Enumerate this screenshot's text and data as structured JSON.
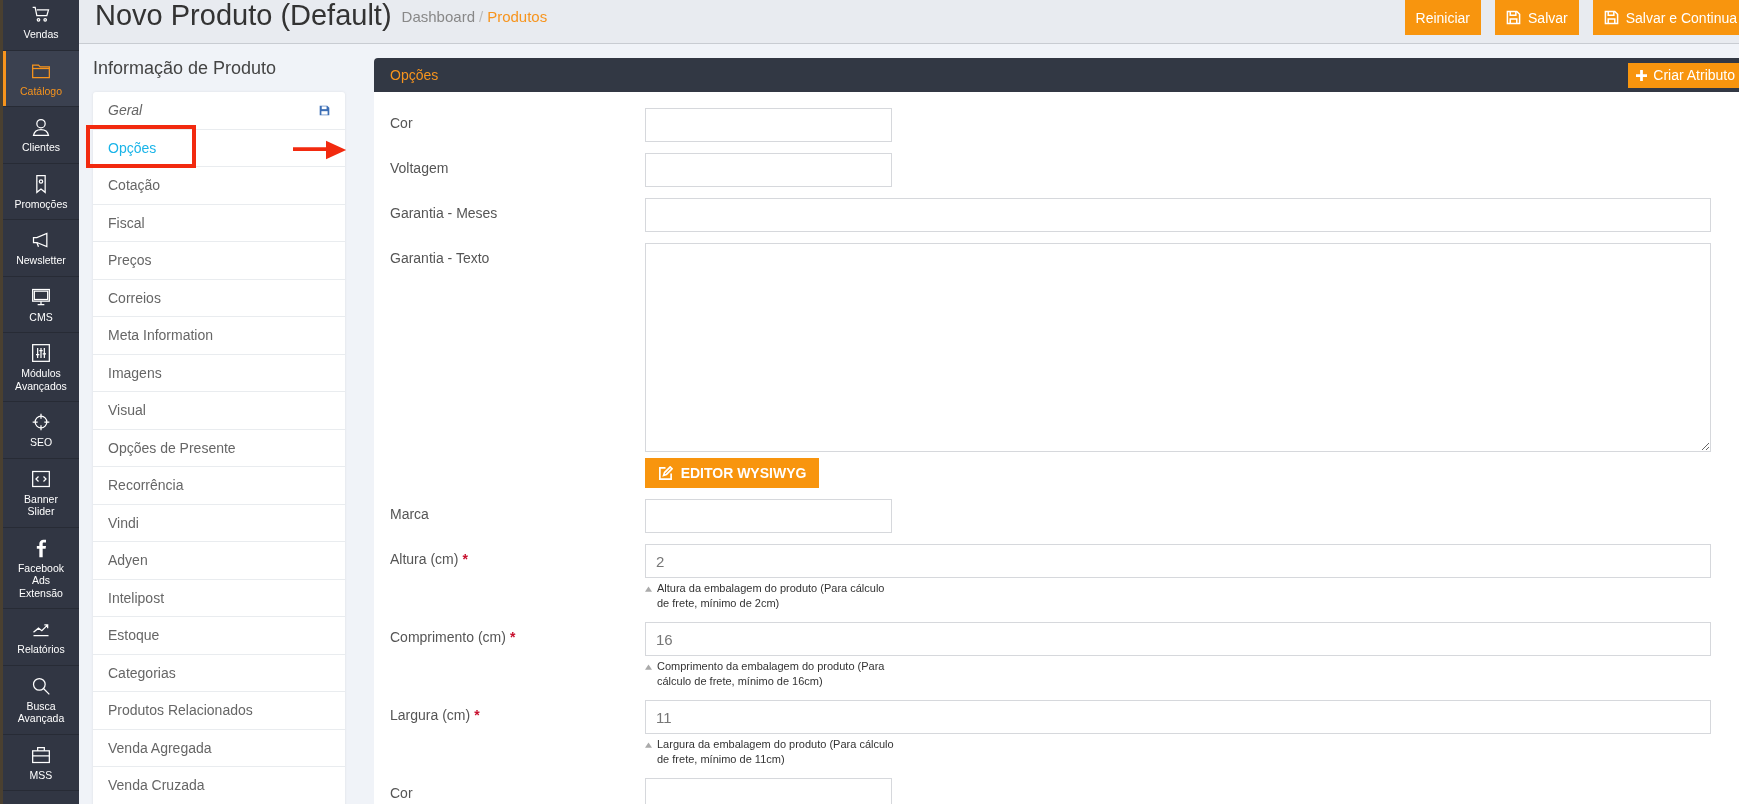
{
  "sidebar": {
    "items": [
      {
        "label": "Vendas",
        "selected": false
      },
      {
        "label": "Catálogo",
        "selected": true
      },
      {
        "label": "Clientes",
        "selected": false
      },
      {
        "label": "Promoções",
        "selected": false
      },
      {
        "label": "Newsletter",
        "selected": false
      },
      {
        "label": "CMS",
        "selected": false
      },
      {
        "label": "Módulos\nAvançados",
        "selected": false
      },
      {
        "label": "SEO",
        "selected": false
      },
      {
        "label": "Banner\nSlider",
        "selected": false
      },
      {
        "label": "Facebook\nAds\nExtensão",
        "selected": false
      },
      {
        "label": "Relatórios",
        "selected": false
      },
      {
        "label": "Busca\nAvançada",
        "selected": false
      },
      {
        "label": "MSS",
        "selected": false
      }
    ]
  },
  "header": {
    "title": "Novo Produto (Default)",
    "breadcrumb": {
      "items": [
        "Dashboard",
        "Produtos"
      ],
      "separator": "/"
    },
    "buttons": [
      {
        "label": "Reiniciar",
        "icon": false
      },
      {
        "label": "Salvar",
        "icon": true
      },
      {
        "label": "Salvar e Continua",
        "icon": true
      }
    ]
  },
  "product_tabs": {
    "title": "Informação de Produto",
    "items": [
      {
        "label": "Geral",
        "kind": "heading",
        "selected": false
      },
      {
        "label": "Opções",
        "kind": "tab",
        "selected": true
      },
      {
        "label": "Cotação",
        "kind": "tab",
        "selected": false
      },
      {
        "label": "Fiscal",
        "kind": "tab",
        "selected": false
      },
      {
        "label": "Preços",
        "kind": "tab",
        "selected": false
      },
      {
        "label": "Correios",
        "kind": "tab",
        "selected": false
      },
      {
        "label": "Meta Information",
        "kind": "tab",
        "selected": false
      },
      {
        "label": "Imagens",
        "kind": "tab",
        "selected": false
      },
      {
        "label": "Visual",
        "kind": "tab",
        "selected": false
      },
      {
        "label": "Opções de Presente",
        "kind": "tab",
        "selected": false
      },
      {
        "label": "Recorrência",
        "kind": "tab",
        "selected": false
      },
      {
        "label": "Vindi",
        "kind": "tab",
        "selected": false
      },
      {
        "label": "Adyen",
        "kind": "tab",
        "selected": false
      },
      {
        "label": "Intelipost",
        "kind": "tab",
        "selected": false
      },
      {
        "label": "Estoque",
        "kind": "tab",
        "selected": false
      },
      {
        "label": "Categorias",
        "kind": "tab",
        "selected": false
      },
      {
        "label": "Produtos Relacionados",
        "kind": "tab",
        "selected": false
      },
      {
        "label": "Venda Agregada",
        "kind": "tab",
        "selected": false
      },
      {
        "label": "Venda Cruzada",
        "kind": "tab",
        "selected": false
      }
    ]
  },
  "panel": {
    "title": "Opções",
    "action": "Criar Atributo",
    "fields": [
      {
        "label": "Cor",
        "kind": "short_input",
        "required": false
      },
      {
        "label": "Voltagem",
        "kind": "short_input",
        "required": false
      },
      {
        "label": "Garantia - Meses",
        "kind": "long_input",
        "required": false
      },
      {
        "label": "Garantia - Texto",
        "kind": "textarea",
        "required": false,
        "button": "EDITOR WYSIWYG"
      },
      {
        "label": "Marca",
        "kind": "short_input",
        "required": false
      },
      {
        "label": "Altura (cm)",
        "kind": "long_input",
        "required": true,
        "value": "2",
        "help": "Altura da embalagem do produto (Para cálculo de frete, mínimo de 2cm)"
      },
      {
        "label": "Comprimento (cm)",
        "kind": "long_input",
        "required": true,
        "value": "16",
        "help": "Comprimento da embalagem do produto (Para cálculo de frete, mínimo de 16cm)"
      },
      {
        "label": "Largura (cm)",
        "kind": "long_input",
        "required": true,
        "value": "11",
        "help": "Largura da embalagem do produto (Para cálculo de frete, mínimo de 11cm)"
      },
      {
        "label": "Cor",
        "kind": "short_input",
        "required": false
      }
    ],
    "required_mark": "*"
  }
}
